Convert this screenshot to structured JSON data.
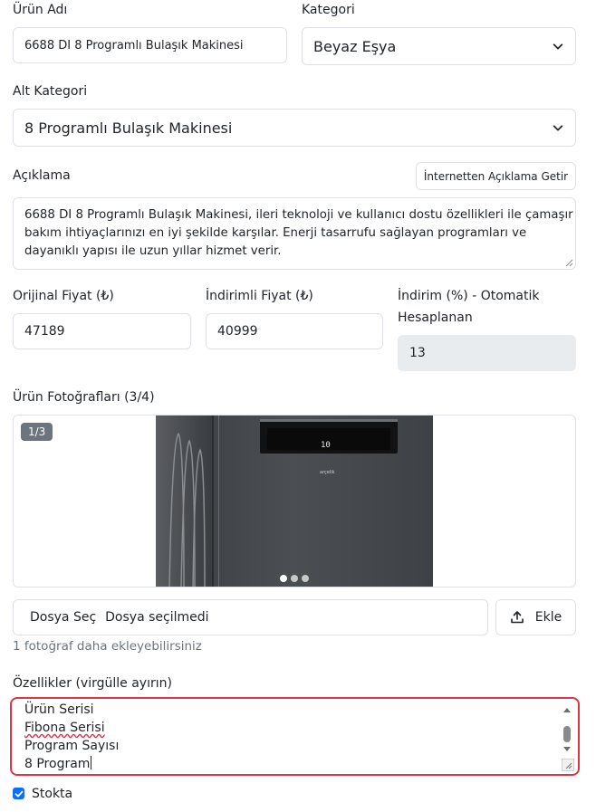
{
  "product_name": {
    "label": "Ürün Adı",
    "value": "6688 DI 8 Programlı Bulaşık Makinesi"
  },
  "category": {
    "label": "Kategori",
    "selected": "Beyaz Eşya"
  },
  "subcategory": {
    "label": "Alt Kategori",
    "selected": "8 Programlı Bulaşık Makinesi"
  },
  "description": {
    "label": "Açıklama",
    "fetch_button": "İnternetten Açıklama Getir",
    "lines": [
      "6688 DI 8 Programlı Bulaşık Makinesi, ileri teknoloji ve kullanıcı dostu özellikleri ile çamaşır",
      "bakım ihtiyaçlarınızı en iyi şekilde karşılar. Enerji tasarrufu sağlayan programları ve",
      "dayanıklı yapısı ile uzun yıllar hizmet verir."
    ]
  },
  "prices": {
    "original_label": "Orijinal Fiyat (₺)",
    "original_value": "47189",
    "discounted_label": "İndirimli Fiyat (₺)",
    "discounted_value": "40999",
    "discount_label_line1": "İndirim (%) - Otomatik",
    "discount_label_line2": "Hesaplanan",
    "discount_value": "13"
  },
  "photos": {
    "label": "Ürün Fotoğrafları (3/4)",
    "counter": "1/3",
    "display_value": "10",
    "brand_mark": "arçelik",
    "slide_count": 3,
    "active_slide": 1
  },
  "upload": {
    "choose_button": "Dosya Seç",
    "status": "Dosya seçilmedi",
    "add_button": "Ekle",
    "hint": "1 fotoğraf daha ekleyebilirsiniz"
  },
  "features": {
    "label": "Özellikler (virgülle ayırın)",
    "line1": "Ürün Serisi",
    "line2": "Fibona Serisi",
    "line3": "Program Sayısı",
    "line4": "8 Program"
  },
  "stock": {
    "label": "Stokta",
    "checked": true
  },
  "colors": {
    "accent": "#0d6efd",
    "error_border": "#dc3545",
    "muted_text": "#6c757d"
  }
}
